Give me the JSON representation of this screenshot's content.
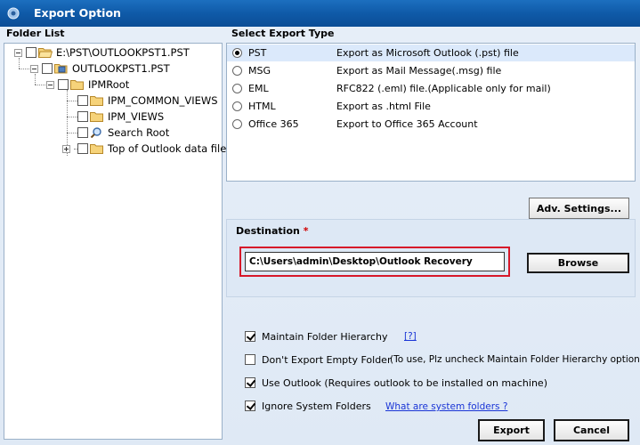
{
  "window": {
    "title": "Export Option"
  },
  "folder_list": {
    "heading": "Folder List",
    "items": [
      {
        "label": "E:\\PST\\OUTLOOKPST1.PST"
      },
      {
        "label": "OUTLOOKPST1.PST"
      },
      {
        "label": "IPMRoot"
      },
      {
        "label": "IPM_COMMON_VIEWS"
      },
      {
        "label": "IPM_VIEWS"
      },
      {
        "label": "Search Root"
      },
      {
        "label": "Top of Outlook data file"
      }
    ]
  },
  "export_type": {
    "heading": "Select Export Type",
    "options": [
      {
        "name": "PST",
        "description": "Export as Microsoft Outlook (.pst) file",
        "selected": true
      },
      {
        "name": "MSG",
        "description": "Export as Mail Message(.msg) file",
        "selected": false
      },
      {
        "name": "EML",
        "description": "RFC822 (.eml) file.(Applicable only for mail)",
        "selected": false
      },
      {
        "name": "HTML",
        "description": "Export as .html File",
        "selected": false
      },
      {
        "name": "Office 365",
        "description": "Export to Office 365 Account",
        "selected": false
      }
    ]
  },
  "adv_settings_label": "Adv. Settings...",
  "destination": {
    "label": "Destination",
    "required_mark": "*",
    "path": "C:\\Users\\admin\\Desktop\\Outlook Recovery",
    "browse_label": "Browse"
  },
  "options": {
    "maintain_hierarchy": {
      "label": "Maintain Folder Hierarchy",
      "checked": true,
      "help": "[?]"
    },
    "dont_export_empty": {
      "label": "Don't Export Empty Folder",
      "checked": false,
      "note": "(To use, Plz uncheck Maintain Folder Hierarchy option)"
    },
    "use_outlook": {
      "label": "Use Outlook (Requires outlook to be installed on machine)",
      "checked": true
    },
    "ignore_system": {
      "label": "Ignore System Folders",
      "checked": true,
      "link": "What are system folders ?"
    }
  },
  "buttons": {
    "export": "Export",
    "cancel": "Cancel"
  },
  "colors": {
    "title_bar": "#0f5aa8",
    "highlight_border": "#d7182a",
    "link": "#1a35d6"
  }
}
